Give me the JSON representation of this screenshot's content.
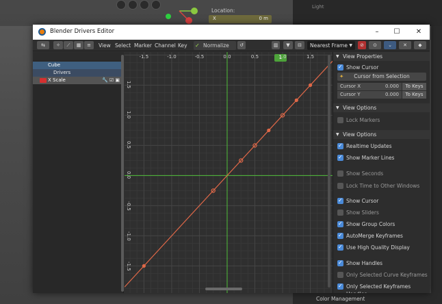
{
  "background": {
    "location_label": "Location:",
    "location_x_label": "X",
    "location_x_value": "0 m",
    "outliner_row": "Light",
    "color_management": "Color Management"
  },
  "window": {
    "title": "Blender Drivers Editor",
    "minimize": "–",
    "maximize": "☐",
    "close": "✕"
  },
  "header": {
    "menus": [
      "View",
      "Select",
      "Marker",
      "Channel",
      "Key"
    ],
    "normalize": "Normalize",
    "snap_mode": "Nearest Frame"
  },
  "channels": {
    "object": "Cube",
    "group": "Drivers",
    "fcurve": "X Scale",
    "fcurve_color": "#d43030"
  },
  "graph": {
    "current_frame": "1",
    "x_ticks": [
      "-1.5",
      "-1.0",
      "-0.5",
      "0.0",
      "0.5",
      "1.0",
      "1.5"
    ],
    "y_ticks": [
      "1.5",
      "1.0",
      "0.5",
      "0.0",
      "-0.5",
      "-1.0",
      "-1.5"
    ],
    "curve_color": "#e06848",
    "cursor_color": "#4fbf3a"
  },
  "chart_data": {
    "type": "line",
    "x": [
      -1.5,
      -0.25,
      0.25,
      0.5,
      0.75,
      1.0,
      1.25,
      1.5
    ],
    "y": [
      -1.5,
      -0.25,
      0.25,
      0.5,
      0.75,
      1.0,
      1.25,
      1.5
    ],
    "keyframes_x": [
      -0.25,
      0.25,
      0.5,
      1.0
    ],
    "keyframes_y": [
      -0.25,
      0.25,
      0.5,
      1.0
    ],
    "xlim": [
      -1.85,
      1.9
    ],
    "ylim": [
      -1.95,
      2.05
    ],
    "cursor": {
      "x": 0.0,
      "y": 0.0
    }
  },
  "sidebar": {
    "view_properties": "View Properties",
    "show_cursor_top": "Show Cursor",
    "cursor_from_selection": "Cursor from Selection",
    "cursor_x_label": "Cursor X",
    "cursor_x_value": "0.000",
    "cursor_y_label": "Cursor Y",
    "cursor_y_value": "0.000",
    "to_keys": "To Keys",
    "view_options_1": "View Options",
    "lock_markers": "Lock Markers",
    "view_options_2": "View Options",
    "options": [
      {
        "label": "Realtime Updates",
        "checked": true
      },
      {
        "label": "Show Marker Lines",
        "checked": true
      },
      {
        "label": "Show Seconds",
        "checked": false
      },
      {
        "label": "Lock Time to Other Windows",
        "checked": false
      },
      {
        "label": "Show Cursor",
        "checked": true
      },
      {
        "label": "Show Sliders",
        "checked": false
      },
      {
        "label": "Show Group Colors",
        "checked": true
      },
      {
        "label": "AutoMerge Keyframes",
        "checked": true
      },
      {
        "label": "Use High Quality Display",
        "checked": true
      },
      {
        "label": "Show Handles",
        "checked": true
      },
      {
        "label": "Only Selected Curve Keyframes",
        "checked": false
      },
      {
        "label": "Only Selected Keyframes Handles",
        "checked": true
      }
    ]
  }
}
